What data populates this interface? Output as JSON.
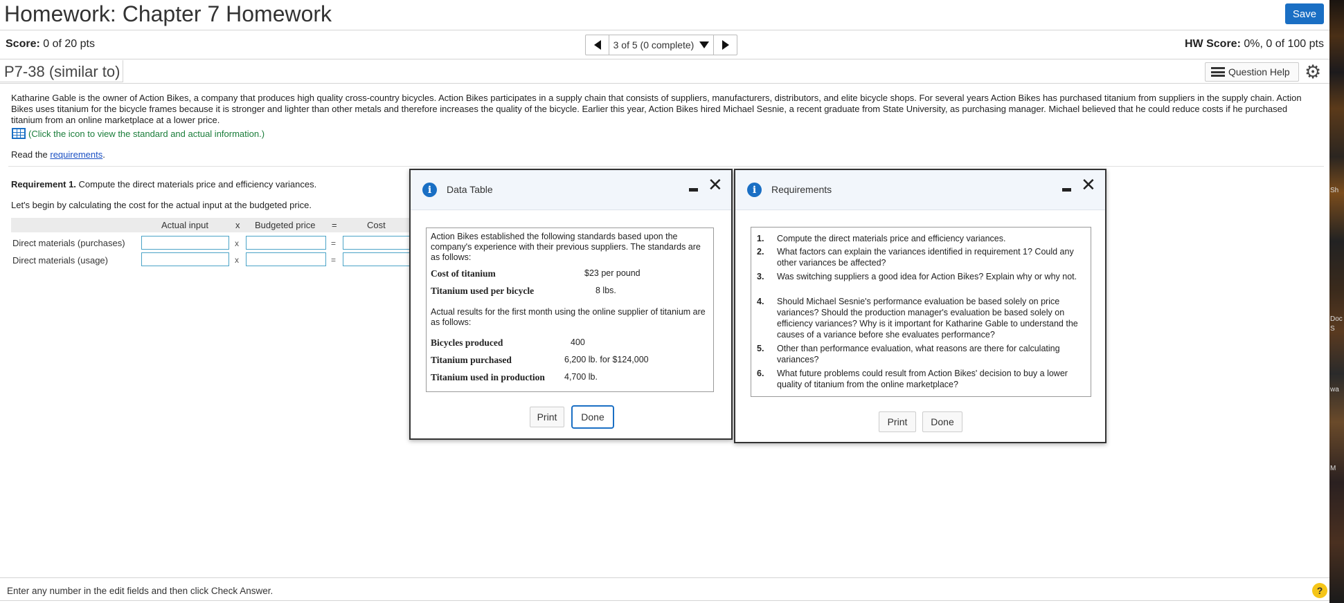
{
  "header": {
    "title": "Homework: Chapter 7 Homework",
    "save_label": "Save",
    "score_label": "Score:",
    "score_value": "0 of 20 pts",
    "nav_position": "3 of 5 (0 complete)",
    "hw_score_label": "HW Score:",
    "hw_score_value": "0%, 0 of 100 pts"
  },
  "question": {
    "id": "P7-38 (similar to)",
    "help_label": "Question Help",
    "problem_text": "Katharine Gable is the owner of Action Bikes, a company that produces high quality cross-country bicycles. Action Bikes participates in a supply chain that consists of suppliers, manufacturers, distributors, and elite bicycle shops. For several years Action Bikes has purchased titanium from suppliers in the supply chain. Action Bikes uses titanium for the bicycle frames because it is stronger and lighter than other metals and therefore increases the quality of the bicycle. Earlier this year, Action Bikes hired Michael Sesnie, a recent graduate from State University, as purchasing manager. Michael believed that he could reduce costs if he purchased titanium from an online marketplace at a lower price.",
    "data_link": "(Click the icon to view the standard and actual information.)",
    "read_prefix": "Read the ",
    "read_link": "requirements",
    "read_suffix": ".",
    "req1_label": "Requirement 1.",
    "req1_text": " Compute the direct materials price and efficiency variances.",
    "begin_text": "Let's begin by calculating the cost for the actual input at the budgeted price."
  },
  "calc_table": {
    "headers": [
      "Actual input",
      "x",
      "Budgeted price",
      "=",
      "Cost"
    ],
    "rows": [
      {
        "label": "Direct materials (purchases)",
        "op1": "x",
        "op2": "=",
        "actual_input": "",
        "budgeted_price": "",
        "cost": ""
      },
      {
        "label": "Direct materials (usage)",
        "op1": "x",
        "op2": "=",
        "actual_input": "",
        "budgeted_price": "",
        "cost": ""
      }
    ]
  },
  "data_table_dialog": {
    "title": "Data Table",
    "intro": "Action Bikes established the following standards based upon the company's experience with their previous suppliers. The standards are as follows:",
    "standards": [
      {
        "label": "Cost of titanium",
        "value": "$23 per pound"
      },
      {
        "label": "Titanium used per bicycle",
        "value": "8 lbs."
      }
    ],
    "actual_intro": "Actual results for the first month using the online supplier of titanium are as follows:",
    "actuals": [
      {
        "label": "Bicycles produced",
        "value": "400"
      },
      {
        "label": "Titanium purchased",
        "value": "6,200 lb. for $124,000"
      },
      {
        "label": "Titanium used in production",
        "value": "4,700 lb."
      }
    ],
    "print_label": "Print",
    "done_label": "Done"
  },
  "requirements_dialog": {
    "title": "Requirements",
    "items": [
      {
        "num": "1.",
        "text": "Compute the direct materials price and efficiency variances."
      },
      {
        "num": "2.",
        "text": "What factors can explain the variances identified in requirement 1? Could any other variances be affected?"
      },
      {
        "num": "3.",
        "text": "Was switching suppliers a good idea for Action Bikes? Explain why or why not."
      },
      {
        "num": "4.",
        "text": "Should Michael Sesnie's performance evaluation be based solely on price variances? Should the production manager's evaluation be based solely on efficiency variances? Why is it important for Katharine Gable to understand the causes of a variance before she evaluates performance?"
      },
      {
        "num": "5.",
        "text": "Other than performance evaluation, what reasons are there for calculating variances?"
      },
      {
        "num": "6.",
        "text": "What future problems could result from Action Bikes' decision to buy a lower quality of titanium from the online marketplace?"
      }
    ],
    "print_label": "Print",
    "done_label": "Done"
  },
  "footer": {
    "instruction": "Enter any number in the edit fields and then click Check Answer.",
    "help_glyph": "?"
  },
  "desktop_strip": {
    "labels": [
      "Sh",
      "Doc",
      "S",
      "wa",
      "M"
    ]
  },
  "colors": {
    "accent": "#1a6fc4",
    "link_green": "#1a7d3a",
    "input_border": "#4aa3c7"
  }
}
